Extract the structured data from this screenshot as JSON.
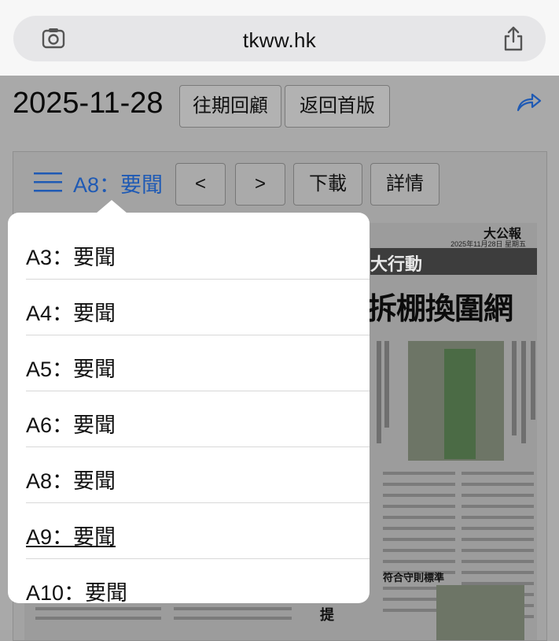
{
  "browser": {
    "url": "tkww.hk"
  },
  "toolbar": {
    "date": "2025-11-28",
    "past_issues_label": "往期回顧",
    "back_to_front_label": "返回首版"
  },
  "viewer": {
    "current_section": "A8：要聞",
    "prev_label": "<",
    "next_label": ">",
    "download_label": "下載",
    "details_label": "詳情"
  },
  "paper": {
    "brand": "大公報",
    "date_line": "2025年11月28日 星期五",
    "banner": "大行動",
    "headline": "拆棚換圍網",
    "sub_head": "符合守則標準",
    "side_char": "提"
  },
  "menu": {
    "items": [
      {
        "label": "A3：要聞"
      },
      {
        "label": "A4：要聞"
      },
      {
        "label": "A5：要聞"
      },
      {
        "label": "A6：要聞"
      },
      {
        "label": "A8：要聞"
      },
      {
        "label": "A9：要聞"
      },
      {
        "label": "A10：要聞"
      }
    ]
  },
  "colors": {
    "accent": "#1f5ab4",
    "overlay": "#a9a9a9",
    "menu_bg": "#ffffff"
  }
}
